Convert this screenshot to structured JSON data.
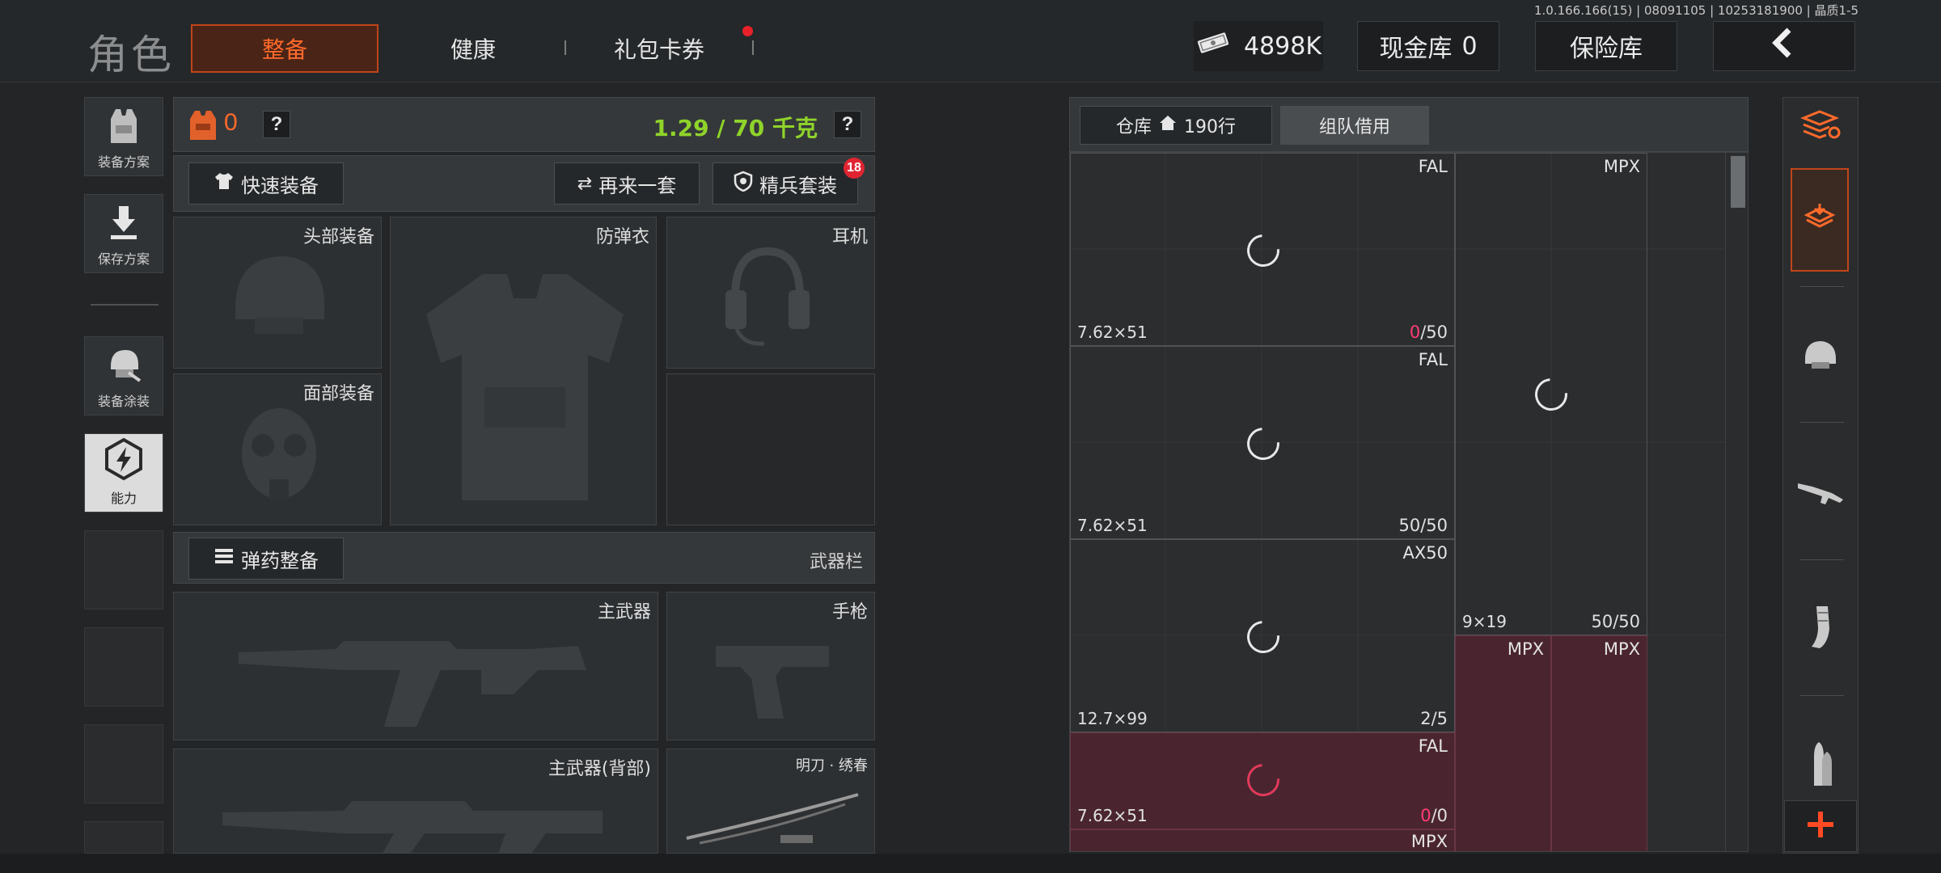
{
  "version": "1.0.166.166(15) | 08091105 | 10253181900 | 晶质1-5",
  "header": {
    "title": "角色",
    "tabs": [
      {
        "label": "整备",
        "active": true
      },
      {
        "label": "健康",
        "active": false
      },
      {
        "label": "礼包卡券",
        "active": false,
        "has_notification": true
      }
    ],
    "currency": {
      "icon": "cash-stack-icon",
      "value": "4898K"
    },
    "cash_vault": {
      "label": "现金库",
      "value": "0"
    },
    "safe_box": "保险库",
    "back_icon": "chevron-left-icon"
  },
  "left_rail": [
    {
      "label": "装备方案",
      "icon": "vest-icon"
    },
    {
      "label": "保存方案",
      "icon": "download-icon"
    },
    {
      "label": "装备涂装",
      "icon": "helmet-paint-icon"
    },
    {
      "label": "能力",
      "icon": "lightning-hexagon-icon",
      "selected": true
    }
  ],
  "equipment": {
    "armor_count": "0",
    "weight": "1.29 / 70 千克",
    "quick_equip": "快速装备",
    "again": "再来一套",
    "elite_set": "精兵套装",
    "elite_badge": "18",
    "slots": {
      "head": "头部装备",
      "armor": "防弹衣",
      "headset": "耳机",
      "face": "面部装备"
    },
    "ammo_button": "弹药整备",
    "weapon_bar": "武器栏",
    "weapons": {
      "primary": "主武器",
      "pistol": "手枪",
      "primary_back": "主武器(背部)",
      "melee": "明刀 · 绣春"
    }
  },
  "warehouse": {
    "tab_storage": "仓库",
    "storage_rows": "190行",
    "tab_team": "组队借用",
    "items": [
      {
        "name": "FAL",
        "caliber": "7.62×51",
        "count_zero": "0",
        "count_rest": "/50"
      },
      {
        "name": "MPX",
        "caliber": "9×19",
        "count": "50/50"
      },
      {
        "name": "FAL",
        "caliber": "7.62×51",
        "count": "50/50"
      },
      {
        "name": "AX50",
        "caliber": "12.7×99",
        "count": "2/5"
      },
      {
        "name": "MPX"
      },
      {
        "name": "MPX"
      },
      {
        "name": "FAL",
        "caliber": "7.62×51",
        "count_zero": "0",
        "count_rest": "/0"
      },
      {
        "name": "MPX"
      }
    ]
  },
  "categories": [
    "all-items-icon",
    "backpack-icon",
    "helmet-icon",
    "rifle-icon",
    "magazine-icon",
    "bullet-icon",
    "add-icon"
  ],
  "colors": {
    "accent": "#ff6a2b",
    "weight_green": "#8fd42a",
    "alert_pink": "#ff3c73"
  }
}
